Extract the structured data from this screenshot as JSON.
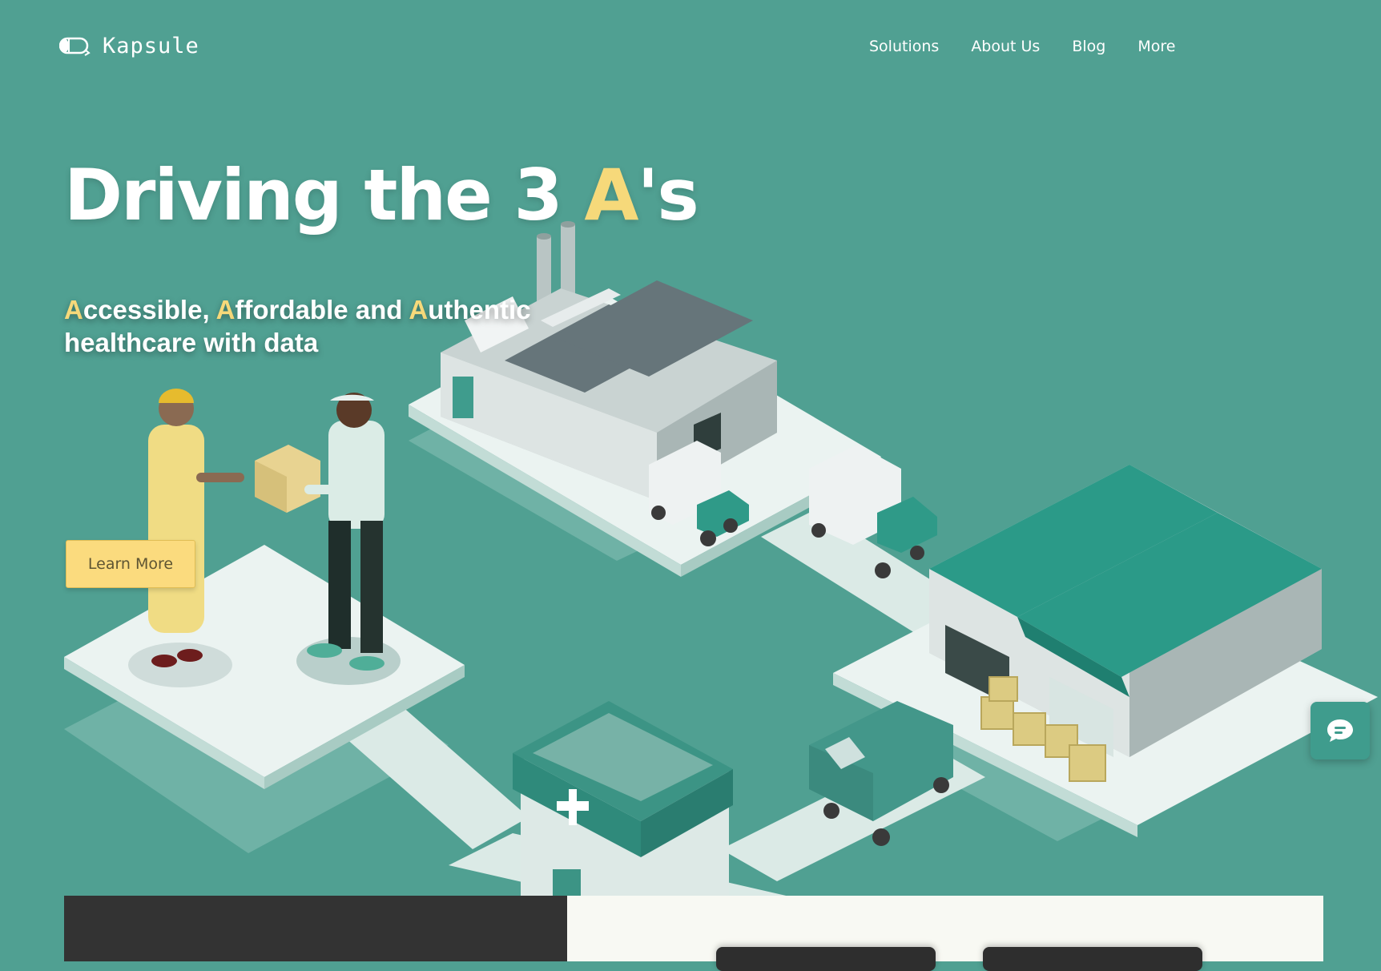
{
  "brand": {
    "name": "Kapsule",
    "logo_icon": "capsule-logo-icon"
  },
  "nav": {
    "items": [
      "Solutions",
      "About Us",
      "Blog",
      "More"
    ]
  },
  "hero": {
    "title_pre": "Driving the 3 ",
    "title_accent": "A",
    "title_post": "'s",
    "subtitle_a1": "A",
    "subtitle_t1": "ccessible, ",
    "subtitle_a2": "A",
    "subtitle_t2": "ffordable and ",
    "subtitle_a3": "A",
    "subtitle_t3": "uthentic healthcare with data",
    "cta_label": "Learn More"
  },
  "chat_widget": {
    "icon": "chat-bubble-icon"
  },
  "colors": {
    "background": "#50a092",
    "accent_yellow": "#f6d97a",
    "button": "#fbdb7e",
    "panel_dark": "#333333",
    "panel_light": "#f8f9f3"
  }
}
